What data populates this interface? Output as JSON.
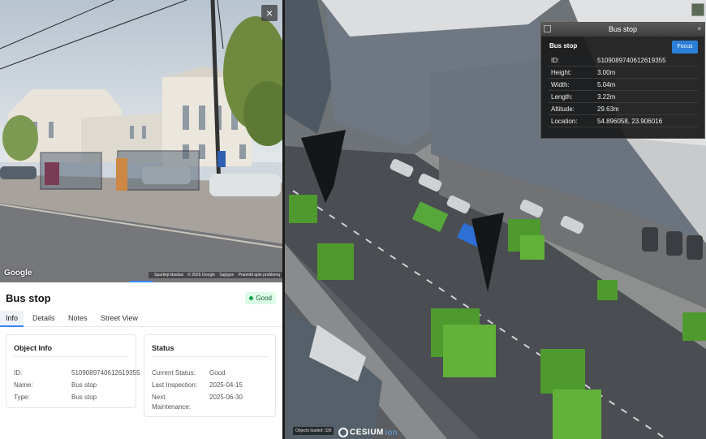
{
  "street_view": {
    "close_glyph": "×",
    "google_logo": "Google",
    "attribution": [
      "Spartieji klavišai",
      "© 2026 Google",
      "Sąlygos",
      "Pranešti apie problemą"
    ]
  },
  "panel": {
    "title": "Bus stop",
    "status_badge": "Good",
    "tabs": [
      "Info",
      "Details",
      "Notes",
      "Street View"
    ],
    "active_tab": "Info",
    "object_info": {
      "title": "Object Info",
      "rows": [
        {
          "label": "ID:",
          "value": "5109089740612619355"
        },
        {
          "label": "Name:",
          "value": "Bus stop"
        },
        {
          "label": "Type:",
          "value": "Bus stop"
        }
      ]
    },
    "status": {
      "title": "Status",
      "rows": [
        {
          "label": "Current Status:",
          "value": "Good"
        },
        {
          "label": "Last Inspection:",
          "value": "2025-04-15"
        },
        {
          "label": "Next",
          "value": "2025-06-30"
        },
        {
          "label": "Maintenance:",
          "value": ""
        }
      ]
    }
  },
  "map": {
    "objects_loaded": "Objects loaded: 328",
    "cesium_brand": "CESIUM",
    "cesium_ion": "ion"
  },
  "infobox": {
    "header_title": "Bus stop",
    "close_glyph": "×",
    "name": "Bus stop",
    "focus_label": "Focus",
    "rows": [
      {
        "label": "ID:",
        "value": "5109089740612619355"
      },
      {
        "label": "Height:",
        "value": "3.00m"
      },
      {
        "label": "Width:",
        "value": "5.04m"
      },
      {
        "label": "Length:",
        "value": "3.22m"
      },
      {
        "label": "Altitude:",
        "value": "29.63m"
      },
      {
        "label": "Location:",
        "value": "54.896058, 23.906016"
      }
    ]
  },
  "colors": {
    "accent": "#3b82f6",
    "good_badge_bg": "#dcfce7",
    "good_badge_text": "#166534",
    "focus_button": "#2b7fd8"
  }
}
